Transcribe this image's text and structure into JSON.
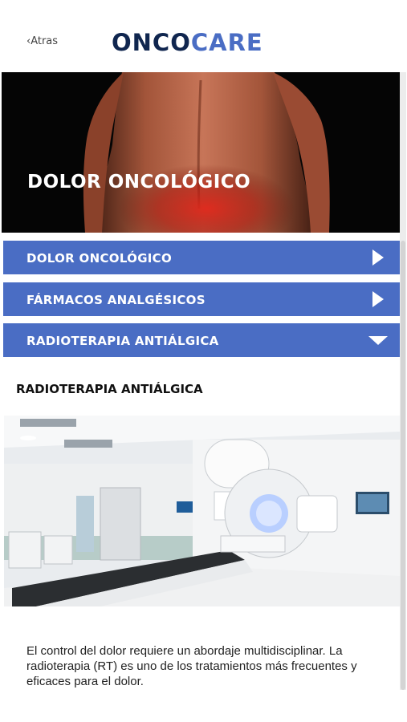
{
  "header": {
    "back_label": "‹Atras",
    "logo_part1": "ONCO",
    "logo_part2": "CARE"
  },
  "hero": {
    "title": "DOLOR ONCOLÓGICO"
  },
  "accordion": [
    {
      "label": "DOLOR ONCOLÓGICO",
      "state": "collapsed",
      "icon": "chevron-right-icon"
    },
    {
      "label": "FÁRMACOS ANALGÉSICOS",
      "state": "collapsed",
      "icon": "chevron-right-icon"
    },
    {
      "label": "RADIOTERAPIA ANTIÁLGICA",
      "state": "expanded",
      "icon": "chevron-down-icon"
    }
  ],
  "section": {
    "heading": "RADIOTERAPIA ANTIÁLGICA",
    "body": "El control del dolor requiere un abordaje multidisciplinar. La radioterapia (RT) es uno de los tratamientos más frecuentes y eficaces para el dolor."
  },
  "colors": {
    "accent": "#4a6dc4",
    "logo_dark": "#10264f",
    "logo_light": "#4a6dc4"
  }
}
